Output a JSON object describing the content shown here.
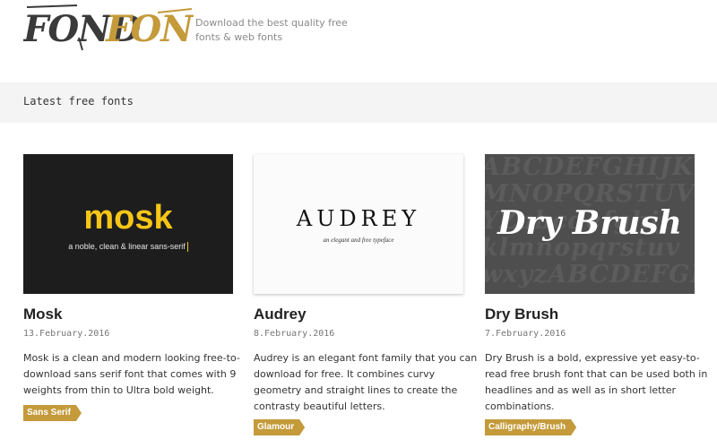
{
  "header": {
    "logo_text": "FONDFONT",
    "logo_part1": "FOND",
    "logo_part2": "FONT",
    "tagline": "Download the best quality free fonts & web fonts"
  },
  "section": {
    "title": "Latest free fonts"
  },
  "colors": {
    "brand_dark": "#3a3a3a",
    "brand_gold": "#c49a3a",
    "tag_bg": "#c49a3a",
    "mosk_yellow": "#f5c518"
  },
  "cards": [
    {
      "title": "Mosk",
      "date": "13.February.2016",
      "description": "Mosk is a clean and modern looking free-to-download sans serif font that comes with 9 weights from thin to Ultra bold weight.",
      "tag": "Sans Serif",
      "preview": {
        "word": "mosk",
        "subtitle": "a noble, clean & linear sans-serif"
      }
    },
    {
      "title": "Audrey",
      "date": "8.February.2016",
      "description": "Audrey is an elegant font family that you can download for free. It combines curvy geometry and straight lines to create the contrasty beautiful letters.",
      "tag": "Glamour",
      "preview": {
        "word": "AUDREY",
        "subtitle": "an elegant and free typeface"
      }
    },
    {
      "title": "Dry Brush",
      "date": "7.February.2016",
      "description": "Dry Brush is a bold, expressive yet easy-to-read free brush font that can be used both in headlines and as well as in short letter combinations.",
      "tag": "Calligraphy/Brush",
      "preview": {
        "word": "Dry Brush",
        "background_letters": "ABCDEFGHIJKL\nMNOPQRSTUVWX\nYZabcdefghij\nklmnopqrstuv\nwxyzABCDEFGH"
      }
    }
  ]
}
